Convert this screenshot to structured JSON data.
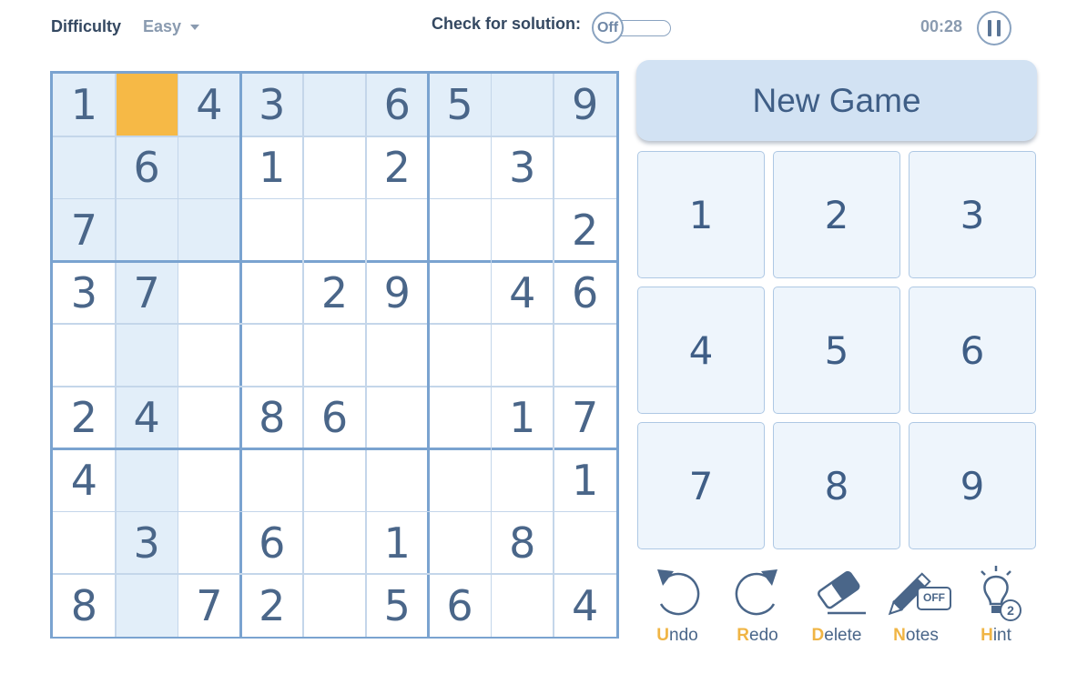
{
  "header": {
    "difficulty_label": "Difficulty",
    "difficulty_value": "Easy",
    "check_label": "Check for solution:",
    "check_toggle_state": "Off",
    "timer": "00:28"
  },
  "board": {
    "selected_cell": [
      0,
      1
    ],
    "highlighted_rows": [
      0
    ],
    "highlighted_cols": [
      1
    ],
    "highlighted_box": [
      0,
      0
    ],
    "cells": [
      [
        "1",
        "",
        "4",
        "3",
        "",
        "6",
        "5",
        "",
        "9"
      ],
      [
        "",
        "6",
        "",
        "1",
        "",
        "2",
        "",
        "3",
        ""
      ],
      [
        "7",
        "",
        "",
        "",
        "",
        "",
        "",
        "",
        "2"
      ],
      [
        "3",
        "7",
        "",
        "",
        "2",
        "9",
        "",
        "4",
        "6"
      ],
      [
        "",
        "",
        "",
        "",
        "",
        "",
        "",
        "",
        ""
      ],
      [
        "2",
        "4",
        "",
        "8",
        "6",
        "",
        "",
        "1",
        "7"
      ],
      [
        "4",
        "",
        "",
        "",
        "",
        "",
        "",
        "",
        "1"
      ],
      [
        "",
        "3",
        "",
        "6",
        "",
        "1",
        "",
        "8",
        ""
      ],
      [
        "8",
        "",
        "7",
        "2",
        "",
        "5",
        "6",
        "",
        "4"
      ]
    ]
  },
  "new_game_label": "New Game",
  "number_pad": [
    "1",
    "2",
    "3",
    "4",
    "5",
    "6",
    "7",
    "8",
    "9"
  ],
  "tools": [
    {
      "name": "undo",
      "initial": "U",
      "rest": "ndo",
      "icon": "undo-icon"
    },
    {
      "name": "redo",
      "initial": "R",
      "rest": "edo",
      "icon": "redo-icon"
    },
    {
      "name": "delete",
      "initial": "D",
      "rest": "elete",
      "icon": "eraser-icon"
    },
    {
      "name": "notes",
      "initial": "N",
      "rest": "otes",
      "icon": "pencil-icon",
      "badge": "OFF"
    },
    {
      "name": "hint",
      "initial": "H",
      "rest": "int",
      "icon": "lightbulb-icon",
      "badge": "2"
    }
  ],
  "colors": {
    "selected_cell": "#f6b946",
    "highlight": "#e2eef9",
    "text": "#4a6689",
    "accent_letter": "#f0b545"
  }
}
